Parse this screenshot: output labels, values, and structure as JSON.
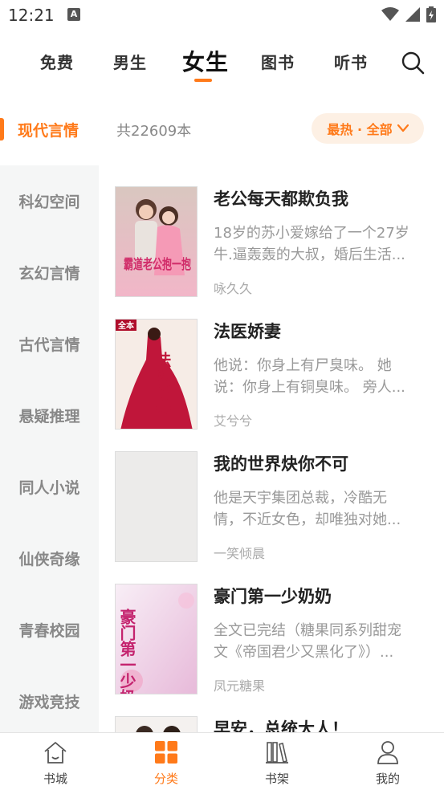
{
  "status_bar": {
    "time": "12:21",
    "notif_letter": "A"
  },
  "top_tabs": [
    {
      "label": "免费",
      "active": false
    },
    {
      "label": "男生",
      "active": false
    },
    {
      "label": "女生",
      "active": true
    },
    {
      "label": "图书",
      "active": false
    },
    {
      "label": "听书",
      "active": false
    }
  ],
  "header": {
    "current_category": "现代言情",
    "count_text": "共22609本",
    "sort_label": "最热 · 全部"
  },
  "sidebar": {
    "items": [
      "科幻空间",
      "玄幻言情",
      "古代言情",
      "悬疑推理",
      "同人小说",
      "仙侠奇缘",
      "青春校园",
      "游戏竞技"
    ]
  },
  "books": [
    {
      "title": "老公每天都欺负我",
      "desc_line1": "18岁的苏小爱嫁给了一个27岁",
      "desc_line2": "牛.逼轰轰的大叔，婚后生活...",
      "author": "咏久久",
      "cover_text": "霸道老公抱一抱"
    },
    {
      "title": "法医娇妻",
      "desc_line1": "他说：你身上有尸臭味。 她",
      "desc_line2": "说：你身上有铜臭味。 旁人...",
      "author": "艾兮兮",
      "cover_text": "法医娇妻",
      "cover_badge": "全本"
    },
    {
      "title": "我的世界炔你不可",
      "desc_line1": "他是天宇集团总裁，冷酷无",
      "desc_line2": "情，不近女色，却唯独对她...",
      "author": "一笑倾晨"
    },
    {
      "title": "豪门第一少奶奶",
      "desc_line1": "全文已完结（糖果同系列甜宠",
      "desc_line2": "文《帝国君少又黑化了》）...",
      "author": "凤元糖果",
      "cover_text": "豪门第一少奶奶"
    },
    {
      "title": "早安，总统大人！"
    }
  ],
  "bottom_nav": [
    {
      "label": "书城",
      "icon": "home-icon",
      "active": false
    },
    {
      "label": "分类",
      "icon": "category-grid-icon",
      "active": true
    },
    {
      "label": "书架",
      "icon": "bookshelf-icon",
      "active": false
    },
    {
      "label": "我的",
      "icon": "user-icon",
      "active": false
    }
  ],
  "colors": {
    "accent": "#ff7a1a",
    "sidebar_bg": "#f5f6f6",
    "pill_bg": "#fdf0e4"
  }
}
